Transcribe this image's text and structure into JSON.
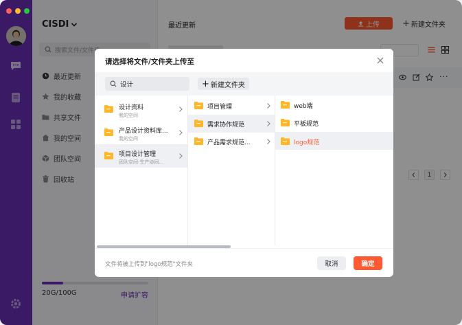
{
  "window": {
    "controls": [
      {
        "name": "close",
        "color": "#ff5f57"
      },
      {
        "name": "minimize",
        "color": "#febc2e"
      },
      {
        "name": "maximize",
        "color": "#28c840"
      }
    ]
  },
  "colors": {
    "brand": "#6a2fb5",
    "accent": "#ff5a32"
  },
  "rail": {
    "icons": [
      "message-icon",
      "document-icon",
      "apps-icon",
      "settings-icon"
    ]
  },
  "sidebar": {
    "workspace": "CISDI",
    "search_placeholder": "搜索文件/文件夹",
    "items": [
      {
        "label": "最近更新",
        "icon": "clock-icon",
        "active": true
      },
      {
        "label": "我的收藏",
        "icon": "star-icon"
      },
      {
        "label": "共享文件",
        "icon": "folder-icon"
      },
      {
        "label": "我的空间",
        "icon": "home-icon"
      },
      {
        "label": "团队空间",
        "icon": "cube-icon"
      },
      {
        "label": "回收站",
        "icon": "trash-icon"
      }
    ],
    "storage": {
      "used_text": "20G/100G",
      "fraction": 0.2,
      "expand_label": "申请扩容"
    }
  },
  "main": {
    "title": "最近更新",
    "upload_label": "上传",
    "new_folder_label": "新建文件夹",
    "page_number": "1"
  },
  "dialog": {
    "title": "请选择将文件/文件夹上传至",
    "search_value": "设计",
    "new_folder_label": "新建文件夹",
    "columns": [
      {
        "items": [
          {
            "name": "设计资料",
            "sub": "我的空间"
          },
          {
            "name": "产品设计资料库...",
            "sub": "我的空间"
          },
          {
            "name": "项目设计管理",
            "sub": "团队空间-生产协同...",
            "selected": true
          }
        ]
      },
      {
        "items": [
          {
            "name": "项目管理"
          },
          {
            "name": "需求协作规范",
            "selected": true
          },
          {
            "name": "产品需求规范..."
          }
        ]
      },
      {
        "items": [
          {
            "name": "web端"
          },
          {
            "name": "平板规范"
          },
          {
            "name": "logo规范",
            "selected": true,
            "highlight": true
          }
        ]
      }
    ],
    "footer_text": "文件将被上传到\"logo规范\"文件夹",
    "cancel_label": "取消",
    "confirm_label": "确定"
  }
}
